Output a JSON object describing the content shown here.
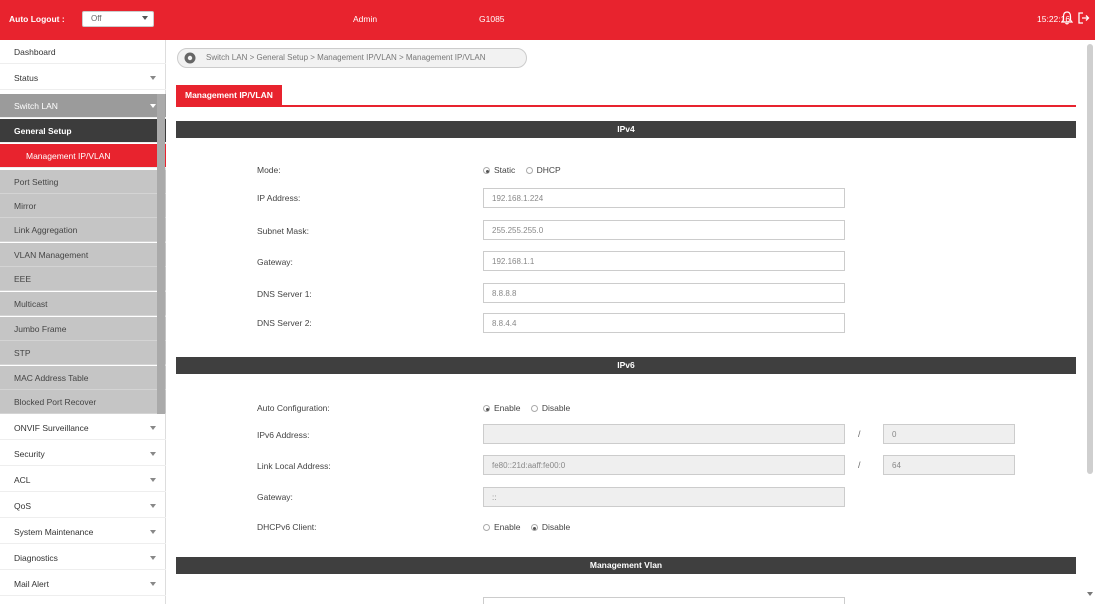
{
  "topbar": {
    "auto_logout_label": "Auto Logout :",
    "auto_logout_value": "Off",
    "user": "Admin",
    "model": "G1085",
    "time": "15:22:16"
  },
  "sidebar": {
    "items": [
      {
        "label": "Dashboard"
      },
      {
        "label": "Status"
      },
      {
        "label": "Switch LAN"
      },
      {
        "label": "General Setup"
      },
      {
        "label": "Management IP/VLAN"
      },
      {
        "label": "Port Setting"
      },
      {
        "label": "Mirror"
      },
      {
        "label": "Link Aggregation"
      },
      {
        "label": "VLAN Management"
      },
      {
        "label": "EEE"
      },
      {
        "label": "Multicast"
      },
      {
        "label": "Jumbo Frame"
      },
      {
        "label": "STP"
      },
      {
        "label": "MAC Address Table"
      },
      {
        "label": "Blocked Port Recover"
      },
      {
        "label": "ONVIF Surveillance"
      },
      {
        "label": "Security"
      },
      {
        "label": "ACL"
      },
      {
        "label": "QoS"
      },
      {
        "label": "System Maintenance"
      },
      {
        "label": "Diagnostics"
      },
      {
        "label": "Mail Alert"
      }
    ]
  },
  "breadcrumb": "Switch LAN > General Setup > Management IP/VLAN > Management IP/VLAN",
  "tab": "Management IP/VLAN",
  "ipv4": {
    "header": "IPv4",
    "mode_label": "Mode:",
    "mode_static": "Static",
    "mode_dhcp": "DHCP",
    "ip_label": "IP Address:",
    "ip_value": "192.168.1.224",
    "mask_label": "Subnet Mask:",
    "mask_value": "255.255.255.0",
    "gateway_label": "Gateway:",
    "gateway_value": "192.168.1.1",
    "dns1_label": "DNS Server 1:",
    "dns1_value": "8.8.8.8",
    "dns2_label": "DNS Server 2:",
    "dns2_value": "8.8.4.4"
  },
  "ipv6": {
    "header": "IPv6",
    "autoconf_label": "Auto Configuration:",
    "enable": "Enable",
    "disable": "Disable",
    "addr_label": "IPv6 Address:",
    "addr_value": "",
    "addr_prefix": "0",
    "link_label": "Link Local Address:",
    "link_value": "fe80::21d:aaff:fe00:0",
    "link_prefix": "64",
    "gateway_label": "Gateway:",
    "gateway_value": "::",
    "dhcpv6_label": "DHCPv6 Client:",
    "slash": "/"
  },
  "management_vlan": {
    "header": "Management Vlan"
  }
}
